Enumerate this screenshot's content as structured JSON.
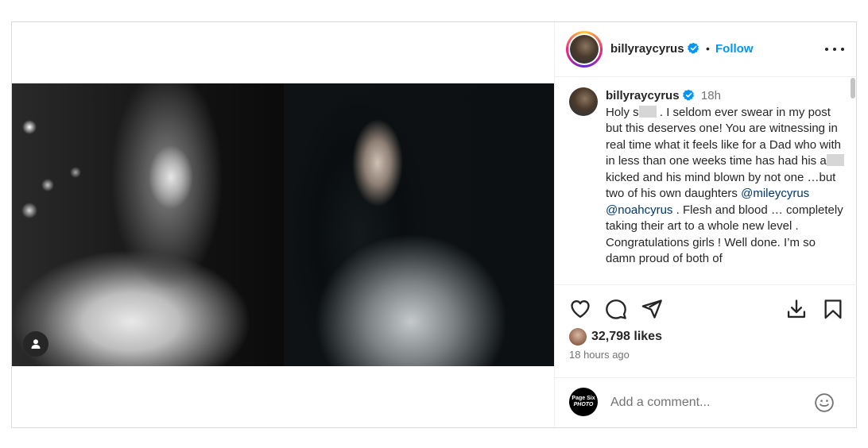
{
  "header": {
    "username": "billyraycyrus",
    "separator": "•",
    "follow_label": "Follow",
    "icons": {
      "verified": "verified-badge-icon",
      "more": "more-options-icon"
    }
  },
  "caption": {
    "username": "billyraycyrus",
    "time": "18h",
    "text_1": "Holy s",
    "text_2": " . I seldom ever swear in my post but this deserves one! You are witnessing in real time what it feels like for a Dad who with in less than one weeks time has had his a",
    "text_3": " kicked and his mind blown by not one …but two of his own daughters ",
    "mention_1": "@mileycyrus",
    "mention_2": "@noahcyrus",
    "text_4": " . Flesh and blood … completely taking their art to a whole new level . Congratulations girls ! Well done.  I’m so damn proud of both of"
  },
  "actions": {
    "icons": [
      "heart-icon",
      "comment-icon",
      "share-icon",
      "download-icon",
      "bookmark-icon"
    ],
    "likes": "32,798 likes",
    "time_ago": "18 hours ago"
  },
  "comment_box": {
    "avatar_line1": "Page Six",
    "avatar_line2": "PHOTO",
    "placeholder": "Add a comment...",
    "icon": "emoji-icon"
  },
  "media": {
    "tag_icon": "user-tag-icon"
  },
  "colors": {
    "accent": "#0095f6",
    "mention": "#00376b",
    "text": "#262626",
    "muted": "#737373",
    "border": "#dbdbdb"
  }
}
